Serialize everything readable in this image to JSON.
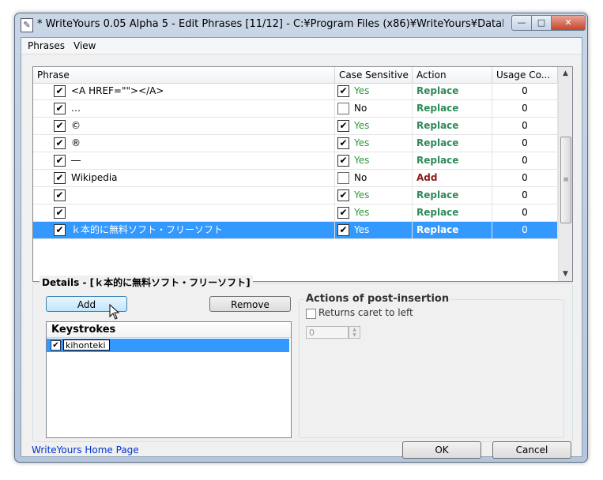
{
  "window": {
    "title": "* WriteYours 0.05 Alpha 5 - Edit Phrases [11/12] - C:¥Program Files (x86)¥WriteYours¥Databas...",
    "min_glyph": "—",
    "max_glyph": "□",
    "close_glyph": "✕"
  },
  "menu": {
    "phrases": "Phrases",
    "view": "View"
  },
  "grid": {
    "columns": [
      "Phrase",
      "Case Sensitive",
      "Action",
      "Usage Co..."
    ],
    "rows": [
      {
        "phrase": "<A HREF=\"\"></A>",
        "case": "Yes",
        "action": "Replace",
        "usage": "0"
      },
      {
        "phrase": "…",
        "case": "No",
        "action": "Replace",
        "usage": "0"
      },
      {
        "phrase": "©",
        "case": "Yes",
        "action": "Replace",
        "usage": "0"
      },
      {
        "phrase": "®",
        "case": "Yes",
        "action": "Replace",
        "usage": "0"
      },
      {
        "phrase": "―",
        "case": "Yes",
        "action": "Replace",
        "usage": "0"
      },
      {
        "phrase": "Wikipedia",
        "case": "No",
        "action": "Add",
        "usage": "0"
      },
      {
        "phrase": "",
        "case": "Yes",
        "action": "Replace",
        "usage": "0"
      },
      {
        "phrase": "",
        "case": "Yes",
        "action": "Replace",
        "usage": "0"
      },
      {
        "phrase": "ｋ本的に無料ソフト・フリーソフト",
        "case": "Yes",
        "action": "Replace",
        "usage": "0"
      }
    ]
  },
  "details": {
    "title": "Details - [ｋ本的に無料ソフト・フリーソフト]",
    "add_label": "Add",
    "remove_label": "Remove",
    "keystrokes_header": "Keystrokes",
    "keystroke_value": "kihonteki"
  },
  "post": {
    "title": "Actions of post-insertion",
    "returns_label": "Returns caret to left",
    "spin_value": "0"
  },
  "footer": {
    "home_link": "WriteYours Home Page",
    "ok_label": "OK",
    "cancel_label": "Cancel"
  }
}
